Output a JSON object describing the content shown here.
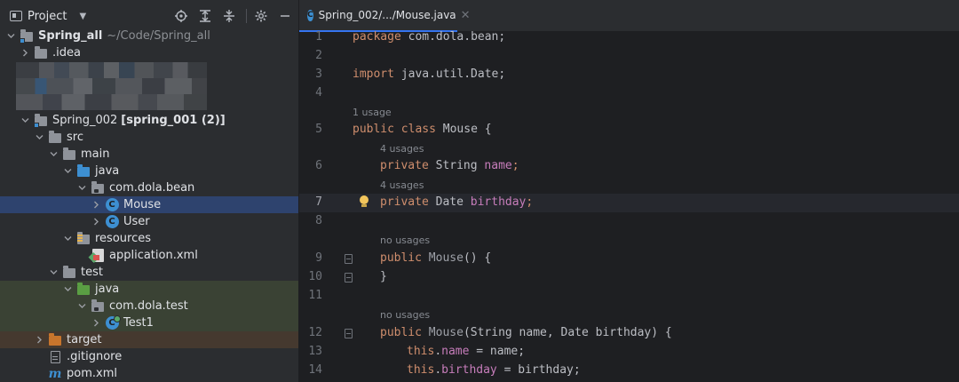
{
  "project_panel": {
    "title": "Project",
    "toolbar_icons": [
      "locate-icon",
      "expand-all-icon",
      "collapse-all-icon",
      "settings-icon",
      "minimize-icon"
    ]
  },
  "tree": {
    "root": {
      "name": "Spring_all",
      "path": "~/Code/Spring_all"
    },
    "idea": ".idea",
    "module": {
      "name": "Spring_002",
      "suffix": "[spring_001 (2)]"
    },
    "src": "src",
    "main": "main",
    "java_main": "java",
    "pkg_main": "com.dola.bean",
    "mouse": "Mouse",
    "user": "User",
    "resources": "resources",
    "appxml": "application.xml",
    "test": "test",
    "java_test": "java",
    "pkg_test": "com.dola.test",
    "test1": "Test1",
    "target": "target",
    "gitignore": ".gitignore",
    "pom": "pom.xml"
  },
  "editor": {
    "tab_label": "Spring_002/.../Mouse.java",
    "lines": {
      "l1": {
        "n": "1",
        "package": "package",
        "pkg": " com.dola.bean;"
      },
      "l2": {
        "n": "2"
      },
      "l3": {
        "n": "3",
        "import": "import",
        "imp": " java.util.Date;"
      },
      "l4": {
        "n": "4"
      },
      "h5": "1 usage",
      "l5": {
        "n": "5",
        "k1": "public",
        "k2": " class",
        "rest": " Mouse {"
      },
      "h6": "4 usages",
      "l6": {
        "n": "6",
        "k": "private",
        "type": " String ",
        "field": "name",
        "end": ";"
      },
      "h7": "4 usages",
      "l7": {
        "n": "7",
        "k": "private",
        "type": " Date ",
        "field": "birthday",
        "end": ";"
      },
      "l8": {
        "n": "8"
      },
      "h9": "no usages",
      "l9": {
        "n": "9",
        "k": "public",
        "ctor": " Mouse",
        "rest": "() {"
      },
      "l10": {
        "n": "10",
        "rest": "}"
      },
      "l11": {
        "n": "11"
      },
      "h12": "no usages",
      "l12": {
        "n": "12",
        "k": "public",
        "ctor": " Mouse",
        "rest": "(String name, Date birthday) {"
      },
      "l13": {
        "n": "13",
        "k": "this",
        "dot": ".",
        "field": "name",
        "rest": " = name;"
      },
      "l14": {
        "n": "14",
        "k": "this",
        "dot": ".",
        "field": "birthday",
        "rest": " = birthday;"
      }
    }
  },
  "colors": {
    "selection": "#2e436e",
    "test_bg": "#3a4234",
    "target_bg": "#45392f",
    "keyword": "#cf8e6d",
    "field": "#c77dbb"
  }
}
